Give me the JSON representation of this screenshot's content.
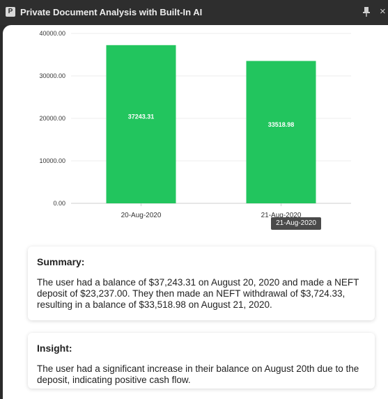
{
  "window": {
    "app_icon_letter": "P",
    "title": "Private Document Analysis with Built-In AI",
    "pin_icon": "pin-icon",
    "close_icon": "close-icon",
    "close_glyph": "×"
  },
  "colors": {
    "bar": "#22c55e",
    "tooltip_bg": "#4a4a4a"
  },
  "chart_data": {
    "type": "bar",
    "categories": [
      "20-Aug-2020",
      "21-Aug-2020"
    ],
    "values": [
      37243.31,
      33518.98
    ],
    "data_labels": [
      "37243.31",
      "33518.98"
    ],
    "ylim": [
      0,
      40000
    ],
    "y_ticks": [
      "0.00",
      "10000.00",
      "20000.00",
      "30000.00",
      "40000.00"
    ],
    "title": "",
    "xlabel": "",
    "ylabel": "",
    "grid": true,
    "legend": "none"
  },
  "tooltip": {
    "text": "21-Aug-2020"
  },
  "summary": {
    "heading": "Summary:",
    "text": "The user had a balance of $37,243.31 on August 20, 2020 and made a NEFT deposit of $23,237.00. They then made an NEFT withdrawal of $3,724.33, resulting in a balance of $33,518.98 on August 21, 2020."
  },
  "insight": {
    "heading": "Insight:",
    "text": "The user had a significant increase in their balance on August 20th due to the deposit, indicating positive cash flow."
  }
}
